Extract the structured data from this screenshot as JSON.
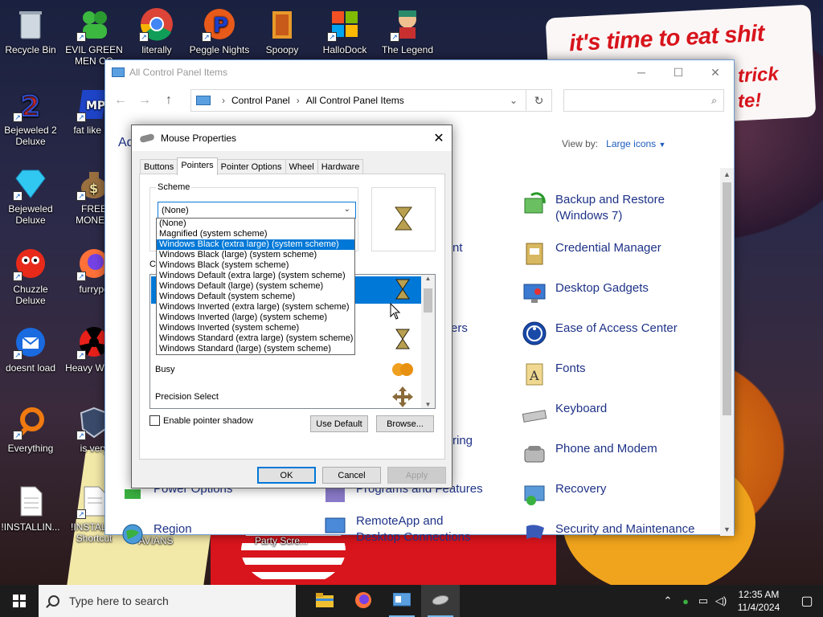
{
  "desktop": {
    "icons": [
      {
        "label": "Recycle Bin",
        "icon": "recycle-bin-icon"
      },
      {
        "label": "EVIL GREEN MEN CO",
        "icon": "green-men-icon"
      },
      {
        "label": "literally",
        "icon": "chrome-icon"
      },
      {
        "label": "Peggle Nights",
        "icon": "peggle-icon"
      },
      {
        "label": "Spoopy",
        "icon": "folder-icon"
      },
      {
        "label": "HalloDock",
        "icon": "windows-logo-icon"
      },
      {
        "label": "The Legend",
        "icon": "character-icon"
      },
      {
        "label": "Bejeweled 2 Deluxe",
        "icon": "bejeweled2-icon"
      },
      {
        "label": "fat like da",
        "icon": "mpa-icon"
      },
      {
        "label": "Bejeweled Deluxe",
        "icon": "diamond-icon"
      },
      {
        "label": "FREE MONEY.",
        "icon": "money-bag-icon"
      },
      {
        "label": "Chuzzle Deluxe",
        "icon": "chuzzle-icon"
      },
      {
        "label": "furrypo",
        "icon": "firefox-icon"
      },
      {
        "label": "doesnt load",
        "icon": "thunderbird-icon"
      },
      {
        "label": "Heavy Weap.",
        "icon": "radiation-icon"
      },
      {
        "label": "Everything",
        "icon": "everything-search-icon"
      },
      {
        "label": "is very",
        "icon": "shield-game-icon"
      },
      {
        "label": "!INSTALLIN...",
        "icon": "document-icon"
      },
      {
        "label": "!INSTALL - Shortcut",
        "icon": "document-icon"
      },
      {
        "label": "AVIANS",
        "icon": "bird-icon"
      },
      {
        "label": "Party Scre...",
        "icon": "party-icon"
      }
    ],
    "sign": {
      "line1": "it's time to eat shit",
      "line2": "trick",
      "line3": "te!"
    }
  },
  "control_panel": {
    "title": "All Control Panel Items",
    "breadcrumb": [
      "Control Panel",
      "All Control Panel Items"
    ],
    "adjust_text": "Ad",
    "view_by_label": "View by:",
    "view_by_value": "Large icons",
    "items_right": [
      {
        "label": "Backup and Restore (Windows 7)",
        "icon": "backup-icon"
      },
      {
        "label": "Credential Manager",
        "icon": "credential-icon"
      },
      {
        "label": "Desktop Gadgets",
        "icon": "gadgets-icon"
      },
      {
        "label": "Ease of Access Center",
        "icon": "ease-of-access-icon"
      },
      {
        "label": "Fonts",
        "icon": "fonts-icon"
      },
      {
        "label": "Keyboard",
        "icon": "keyboard-icon"
      },
      {
        "label": "Phone and Modem",
        "icon": "phone-icon"
      },
      {
        "label": "Recovery",
        "icon": "recovery-icon"
      },
      {
        "label": "Security and Maintenance",
        "icon": "flag-icon"
      }
    ],
    "items_middle_partial": [
      {
        "label": "nt"
      },
      {
        "label": "ers"
      },
      {
        "label": "ring"
      },
      {
        "label": "Programs and Features"
      },
      {
        "label": "RemoteApp and Desktop Connections"
      }
    ],
    "items_left_partial": [
      {
        "label": "Power Options"
      },
      {
        "label": "Region"
      }
    ]
  },
  "mouse_properties": {
    "title": "Mouse Properties",
    "tabs": [
      "Buttons",
      "Pointers",
      "Pointer Options",
      "Wheel",
      "Hardware"
    ],
    "active_tab": "Pointers",
    "scheme_label": "Scheme",
    "scheme_value": "(None)",
    "customize_label": "Cu",
    "cursor_rows": [
      {
        "label": "Busy"
      },
      {
        "label": "Precision Select"
      }
    ],
    "enable_shadow": "Enable pointer shadow",
    "use_default": "Use Default",
    "browse": "Browse...",
    "ok": "OK",
    "cancel": "Cancel",
    "apply": "Apply"
  },
  "scheme_dropdown": {
    "options": [
      "(None)",
      "Magnified (system scheme)",
      "Windows Black (extra large) (system scheme)",
      "Windows Black (large) (system scheme)",
      "Windows Black (system scheme)",
      "Windows Default (extra large) (system scheme)",
      "Windows Default (large) (system scheme)",
      "Windows Default (system scheme)",
      "Windows Inverted (extra large) (system scheme)",
      "Windows Inverted (large) (system scheme)",
      "Windows Inverted (system scheme)",
      "Windows Standard (extra large) (system scheme)",
      "Windows Standard (large) (system scheme)"
    ],
    "highlighted_index": 2
  },
  "taskbar": {
    "search_placeholder": "Type here to search",
    "apps": [
      "file-explorer-icon",
      "firefox-icon",
      "control-panel-icon",
      "mouse-icon"
    ],
    "time": "12:35 AM",
    "date": "11/4/2024"
  }
}
